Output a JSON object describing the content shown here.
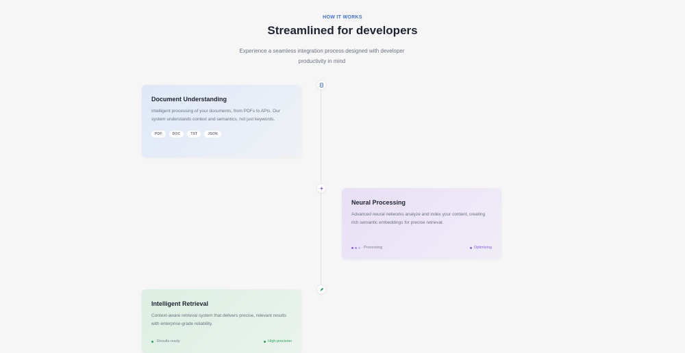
{
  "section": {
    "eyebrow": "HOW IT WORKS",
    "title": "Streamlined for developers",
    "subtitle": "Experience a seamless integration process designed with developer productivity in mind"
  },
  "steps": [
    {
      "icon": "document-icon",
      "title": "Document Understanding",
      "description": "Intelligent processing of your documents, from PDFs to APIs. Our system understands context and semantics, not just keywords.",
      "tags": [
        "PDF",
        "DOC",
        "TXT",
        "JSON"
      ],
      "accent": "#3b6fe0"
    },
    {
      "icon": "sparkle-icon",
      "title": "Neural Processing",
      "description": "Advanced neural networks analyze and index your content, creating rich semantic embeddings for precise retrieval.",
      "status_left": "Processing",
      "status_right": "Optimizing",
      "accent": "#8b5cf6"
    },
    {
      "icon": "rocket-icon",
      "title": "Intelligent Retrieval",
      "description": "Context-aware retrieval system that delivers precise, relevant results with enterprise-grade reliability.",
      "status_left": "Results ready",
      "status_right": "High precision",
      "accent": "#22a55a"
    }
  ]
}
